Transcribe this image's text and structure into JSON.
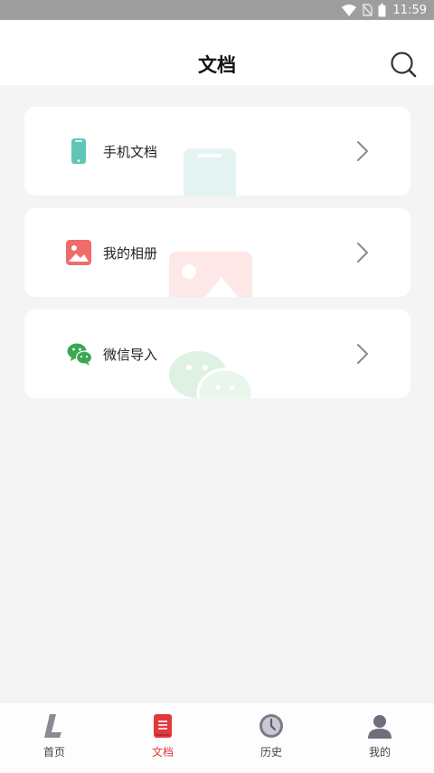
{
  "status_bar": {
    "time": "11:59"
  },
  "header": {
    "title": "文档"
  },
  "cards": [
    {
      "label": "手机文档",
      "icon": "phone-icon",
      "color": "#5fc6b5"
    },
    {
      "label": "我的相册",
      "icon": "photo-album-icon",
      "color": "#f26b6b"
    },
    {
      "label": "微信导入",
      "icon": "wechat-icon",
      "color": "#39a852"
    }
  ],
  "bottom_nav": [
    {
      "label": "首页",
      "icon": "home-logo-icon",
      "active": false
    },
    {
      "label": "文档",
      "icon": "document-icon",
      "active": true
    },
    {
      "label": "历史",
      "icon": "clock-icon",
      "active": false
    },
    {
      "label": "我的",
      "icon": "person-icon",
      "active": false
    }
  ],
  "colors": {
    "accent": "#e0393e",
    "background": "#f4f4f4"
  }
}
